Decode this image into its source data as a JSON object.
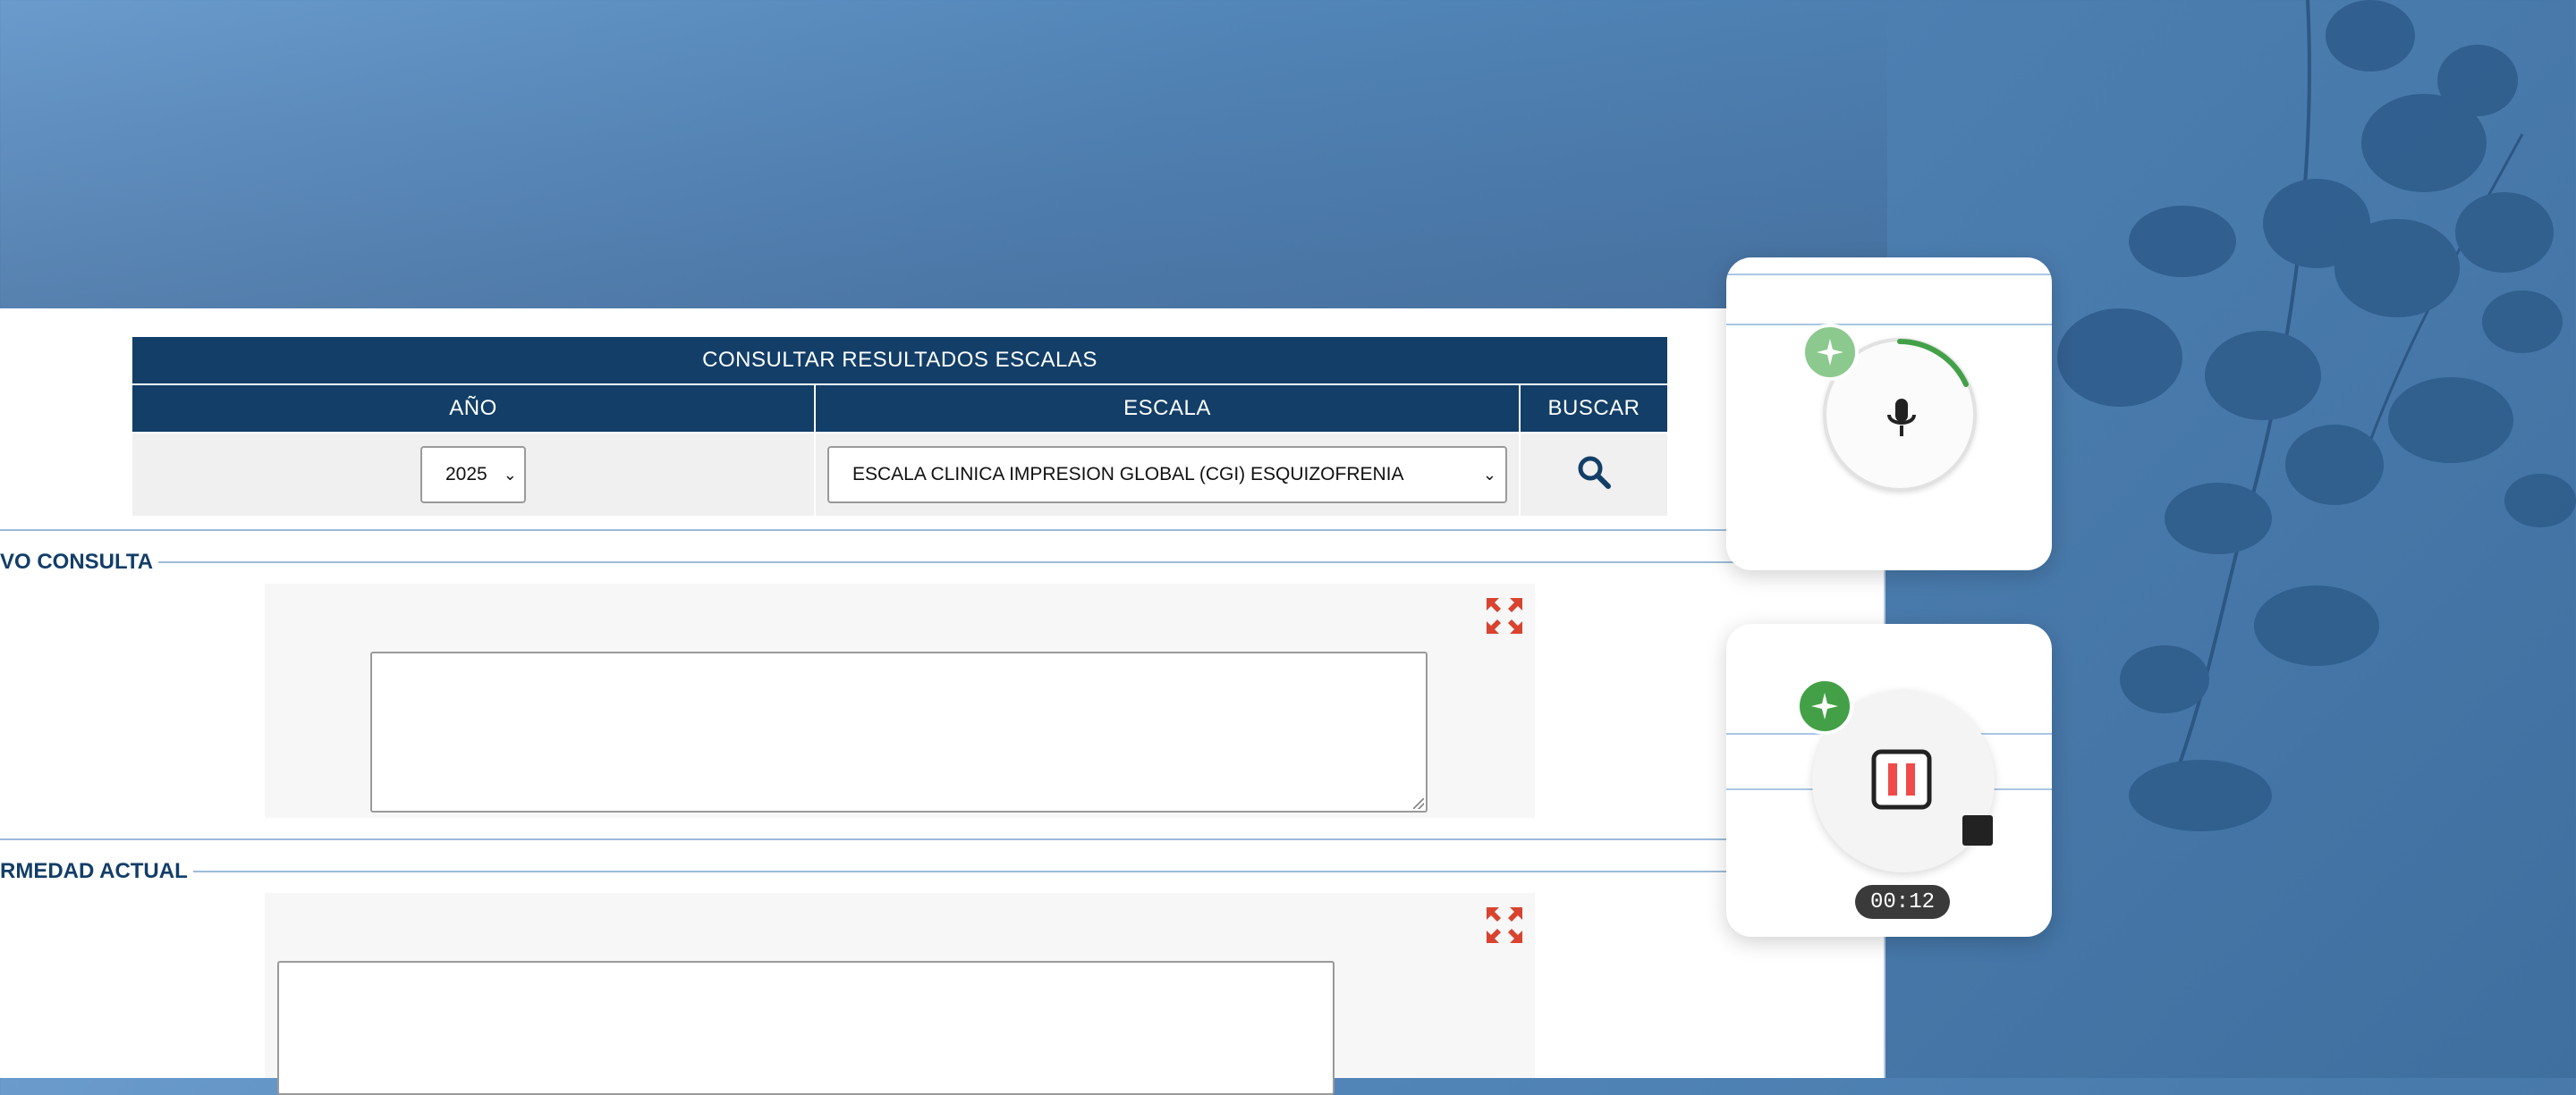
{
  "consult": {
    "title": "CONSULTAR RESULTADOS ESCALAS",
    "col_year": "AÑO",
    "col_scale": "ESCALA",
    "col_search": "BUSCAR",
    "year_value": "2025",
    "scale_value": "ESCALA CLINICA IMPRESION GLOBAL (CGI) ESQUIZOFRENIA"
  },
  "sections": {
    "reason_title": "VO CONSULTA",
    "illness_title": "RMEDAD ACTUAL"
  },
  "recorder": {
    "timer": "00:12"
  },
  "colors": {
    "header_navy": "#123e68",
    "expand_red": "#d9432f",
    "sparkle_green": "#43a047",
    "sparkle_green_light": "#8cc98e",
    "pause_red": "#f04a4a"
  },
  "icons": {
    "search": "search-icon",
    "expand": "expand-icon",
    "mic": "microphone-icon",
    "sparkle": "sparkle-icon",
    "pause": "pause-icon",
    "stop": "stop-icon"
  }
}
